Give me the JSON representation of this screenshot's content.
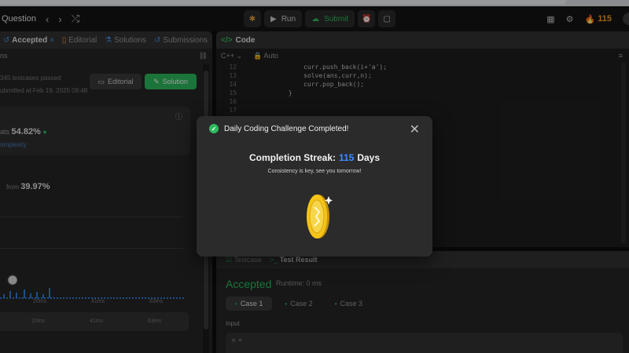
{
  "topbar": {
    "question_label": "Question",
    "run_label": "Run",
    "submit_label": "Submit",
    "streak_count": "115"
  },
  "left_panel": {
    "tabs": {
      "accepted": "Accepted",
      "editorial": "Editorial",
      "solutions": "Solutions",
      "submissions": "Submissions"
    },
    "sub_title": "ns",
    "testcases": "345 testcases passed",
    "submitted_at": "ubmitted at Feb 19, 2025 09:48",
    "editorial_btn": "Editorial",
    "solution_btn": "Solution",
    "beats_prefix": "ats",
    "beats_value": "54.82%",
    "complexity_label": "omplexity",
    "beats2_prefix": "from",
    "beats2_value": "39.97%",
    "ticks_top": [
      "20ms",
      "41ms",
      "63ms"
    ],
    "ticks_bottom": [
      "20ms",
      "41ms",
      "63ms"
    ]
  },
  "code": {
    "header": "Code",
    "language": "C++",
    "mode": "Auto",
    "lines": [
      {
        "n": "12",
        "text": "                curr.push_back(i+'a');"
      },
      {
        "n": "13",
        "text": "                solve(ans,curr,n);"
      },
      {
        "n": "14",
        "text": "                curr.pop_back();"
      },
      {
        "n": "15",
        "text": "            }"
      },
      {
        "n": "16",
        "text": ""
      },
      {
        "n": "17",
        "text": ""
      }
    ]
  },
  "bottom_panel": {
    "tabs": {
      "testcase": "Testcase",
      "test_result": "Test Result"
    },
    "accepted": "Accepted",
    "runtime": "Runtime: 0 ms",
    "cases": [
      "Case 1",
      "Case 2",
      "Case 3"
    ],
    "input_label": "Input",
    "input_value": "n ="
  },
  "modal": {
    "title": "Daily Coding Challenge Completed!",
    "streak_label": "Completion Streak:",
    "streak_value": "115",
    "streak_unit": "Days",
    "message": "Consistency is key, see you tomorrow!"
  },
  "colors": {
    "green": "#2cbb5d",
    "blue": "#3c8dff",
    "orange": "#ffa116",
    "gold": "#f5c518"
  }
}
